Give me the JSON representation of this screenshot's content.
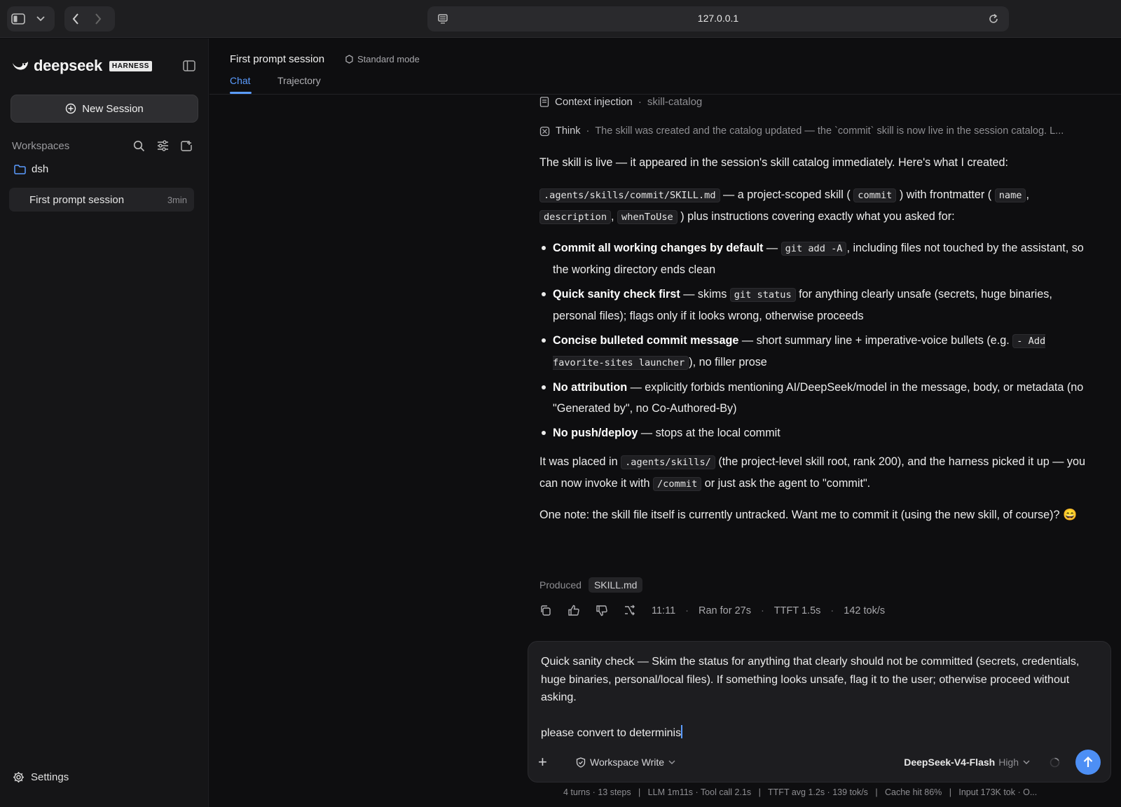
{
  "browser": {
    "url": "127.0.0.1"
  },
  "sidebar": {
    "brand": "deepseek",
    "badge": "HARNESS",
    "new_session": "New Session",
    "workspaces_label": "Workspaces",
    "folder": "dsh",
    "session": {
      "title": "First prompt session",
      "age": "3min"
    },
    "settings": "Settings"
  },
  "header": {
    "title": "First prompt session",
    "mode": "Standard mode",
    "tabs": [
      {
        "label": "Chat",
        "active": true
      },
      {
        "label": "Trajectory",
        "active": false
      }
    ]
  },
  "chat": {
    "context": {
      "label": "Context injection",
      "value": "skill-catalog"
    },
    "think": {
      "label": "Think",
      "text": "The skill was created and the catalog updated — the `commit` skill is now live in the session catalog. L..."
    },
    "intro": "The skill is live — it appeared in the session's skill catalog immediately. Here's what I created:",
    "p2": {
      "path": ".agents/skills/commit/SKILL.md",
      "t1": " — a project-scoped skill (",
      "c1": "commit",
      "t2": ") with frontmatter (",
      "c2": "name",
      "t3": ", ",
      "c3": "description",
      "t4": ", ",
      "c4": "whenToUse",
      "t5": ") plus instructions covering exactly what you asked for:"
    },
    "bullets": [
      {
        "bold": "Commit all working changes by default",
        "pre": " — ",
        "code": "git add -A",
        "post": ", including files not touched by the assistant, so the working directory ends clean"
      },
      {
        "bold": "Quick sanity check first",
        "pre": " — skims ",
        "code": "git status",
        "post": " for anything clearly unsafe (secrets, huge binaries, personal files); flags only if it looks wrong, otherwise proceeds"
      },
      {
        "bold": "Concise bulleted commit message",
        "pre": " — short summary line + imperative-voice bullets (e.g. ",
        "code": "- Add favorite-sites launcher",
        "post": "), no filler prose"
      },
      {
        "bold": "No attribution",
        "pre": " — explicitly forbids mentioning AI/DeepSeek/model in the message, body, or metadata (no \"Generated by\", no Co-Authored-By)",
        "code": "",
        "post": ""
      },
      {
        "bold": "No push/deploy",
        "pre": " — stops at the local commit",
        "code": "",
        "post": ""
      }
    ],
    "p3": {
      "t1": "It was placed in ",
      "c1": ".agents/skills/",
      "t2": " (the project-level skill root, rank 200), and the harness picked it up — you can now invoke it with ",
      "c2": "/commit",
      "t3": " or just ask the agent to \"commit\"."
    },
    "p4": "One note: the skill file itself is currently untracked. Want me to commit it (using the new skill, of course)? 😄",
    "produced_label": "Produced",
    "produced_file": "SKILL.md",
    "time": "11:11",
    "ran": "Ran for 27s",
    "ttft": "TTFT 1.5s",
    "speed": "142 tok/s"
  },
  "composer": {
    "text": "Quick sanity check — Skim the status for anything that clearly should not be committed (secrets, credentials, huge binaries, personal/local files). If something looks unsafe, flag it to the user; otherwise proceed without asking.\n\nplease convert to determinis",
    "permission": "Workspace Write",
    "model": "DeepSeek-V4-Flash",
    "effort": "High"
  },
  "stats": "4 turns · 13 steps   |   LLM 1m11s · Tool call 2.1s   |   TTFT avg 1.2s · 139 tok/s   |   Cache hit 86%   |   Input 173K tok · O...",
  "colors": {
    "accent": "#5b9cff",
    "send": "#4d8ff5",
    "bg": "#0e0e10",
    "sidebar": "#151517"
  }
}
